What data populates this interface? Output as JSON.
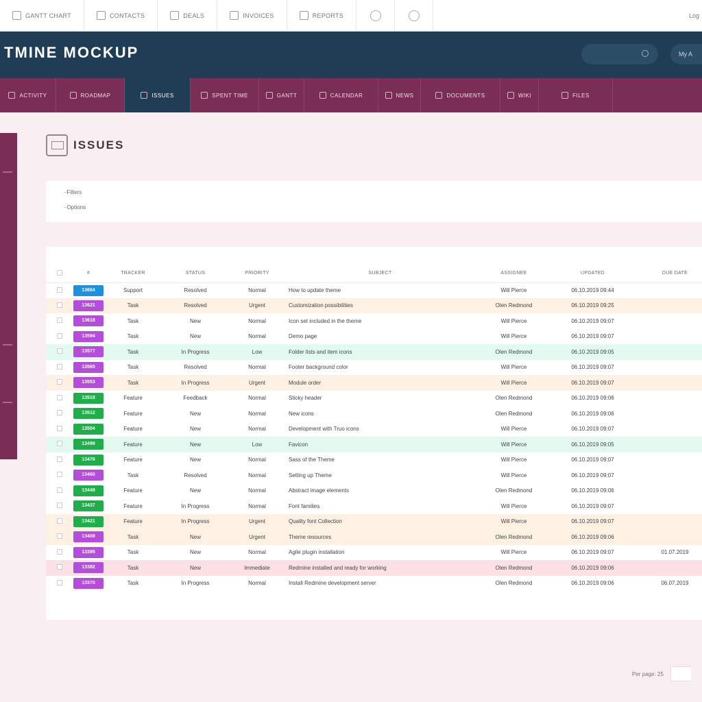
{
  "toolbar": {
    "items": [
      {
        "label": "Gantt chart",
        "icon": "gantt-icon"
      },
      {
        "label": "Contacts",
        "icon": "contacts-icon"
      },
      {
        "label": "Deals",
        "icon": "deals-icon"
      },
      {
        "label": "Invoices",
        "icon": "invoices-icon"
      },
      {
        "label": "Reports",
        "icon": "reports-icon"
      }
    ],
    "right_label": "Log"
  },
  "header": {
    "app_title": "TMINE MOCKUP",
    "my_account": "My A"
  },
  "tabs": [
    {
      "label": "Activity",
      "active": false
    },
    {
      "label": "Roadmap",
      "active": false
    },
    {
      "label": "Issues",
      "active": true
    },
    {
      "label": "Spent time",
      "active": false
    },
    {
      "label": "Gantt",
      "active": false
    },
    {
      "label": "Calendar",
      "active": false
    },
    {
      "label": "News",
      "active": false
    },
    {
      "label": "Documents",
      "active": false
    },
    {
      "label": "Wiki",
      "active": false
    },
    {
      "label": "Files",
      "active": false
    }
  ],
  "page": {
    "title": "Issues"
  },
  "filters": {
    "options": [
      "Filters",
      "Options"
    ]
  },
  "table": {
    "headers": [
      "#",
      "Tracker",
      "Status",
      "Priority",
      "Subject",
      "Assignee",
      "Updated",
      "Due date"
    ],
    "rows": [
      {
        "id": "13664",
        "tracker": "Support",
        "status": "Resolved",
        "priority": "Normal",
        "subject": "How to update theme",
        "assignee": "Will Pierce",
        "updated": "06.10.2019 09:44",
        "due": "",
        "badge": "#1e90e0",
        "hl": ""
      },
      {
        "id": "13621",
        "tracker": "Task",
        "status": "Resolved",
        "priority": "Urgent",
        "subject": "Customization possibilities",
        "assignee": "Olen Redmond",
        "updated": "06.10.2019 09:25",
        "due": "",
        "badge": "#b54ddb",
        "hl": "orange"
      },
      {
        "id": "13618",
        "tracker": "Task",
        "status": "New",
        "priority": "Normal",
        "subject": "Icon set included in the theme",
        "assignee": "Will Pierce",
        "updated": "06.10.2019 09:07",
        "due": "",
        "badge": "#b54ddb",
        "hl": ""
      },
      {
        "id": "13594",
        "tracker": "Task",
        "status": "New",
        "priority": "Normal",
        "subject": "Demo page",
        "assignee": "Will Pierce",
        "updated": "06.10.2019 09:07",
        "due": "",
        "badge": "#b54ddb",
        "hl": ""
      },
      {
        "id": "13577",
        "tracker": "Task",
        "status": "In Progress",
        "priority": "Low",
        "subject": "Folder lists and item icons",
        "assignee": "Olen Redmond",
        "updated": "06.10.2019 09:05",
        "due": "",
        "badge": "#b54ddb",
        "hl": "green"
      },
      {
        "id": "13565",
        "tracker": "Task",
        "status": "Resolved",
        "priority": "Normal",
        "subject": "Footer background color",
        "assignee": "Will Pierce",
        "updated": "06.10.2019 09:07",
        "due": "",
        "badge": "#b54ddb",
        "hl": ""
      },
      {
        "id": "13553",
        "tracker": "Task",
        "status": "In Progress",
        "priority": "Urgent",
        "subject": "Module order",
        "assignee": "Will Pierce",
        "updated": "06.10.2019 09:07",
        "due": "",
        "badge": "#b54ddb",
        "hl": "orange"
      },
      {
        "id": "13518",
        "tracker": "Feature",
        "status": "Feedback",
        "priority": "Normal",
        "subject": "Sticky header",
        "assignee": "Olen Redmond",
        "updated": "06.10.2019 09:06",
        "due": "",
        "badge": "#1fae4a",
        "hl": ""
      },
      {
        "id": "13512",
        "tracker": "Feature",
        "status": "New",
        "priority": "Normal",
        "subject": "New icons",
        "assignee": "Olen Redmond",
        "updated": "06.10.2019 09:06",
        "due": "",
        "badge": "#1fae4a",
        "hl": ""
      },
      {
        "id": "13504",
        "tracker": "Feature",
        "status": "New",
        "priority": "Normal",
        "subject": "Development with Truo icons",
        "assignee": "Will Pierce",
        "updated": "06.10.2019 09:07",
        "due": "",
        "badge": "#1fae4a",
        "hl": ""
      },
      {
        "id": "13499",
        "tracker": "Feature",
        "status": "New",
        "priority": "Low",
        "subject": "Favicon",
        "assignee": "Will Pierce",
        "updated": "06.10.2019 09:05",
        "due": "",
        "badge": "#1fae4a",
        "hl": "green"
      },
      {
        "id": "13476",
        "tracker": "Feature",
        "status": "New",
        "priority": "Normal",
        "subject": "Sass of the Theme",
        "assignee": "Will Pierce",
        "updated": "06.10.2019 09:07",
        "due": "",
        "badge": "#1fae4a",
        "hl": ""
      },
      {
        "id": "13460",
        "tracker": "Task",
        "status": "Resolved",
        "priority": "Normal",
        "subject": "Setting up Theme",
        "assignee": "Will Pierce",
        "updated": "06.10.2019 09:07",
        "due": "",
        "badge": "#b54ddb",
        "hl": ""
      },
      {
        "id": "13449",
        "tracker": "Feature",
        "status": "New",
        "priority": "Normal",
        "subject": "Abstract image elements",
        "assignee": "Olen Redmond",
        "updated": "06.10.2019 09:06",
        "due": "",
        "badge": "#1fae4a",
        "hl": ""
      },
      {
        "id": "13437",
        "tracker": "Feature",
        "status": "In Progress",
        "priority": "Normal",
        "subject": "Font families",
        "assignee": "Will Pierce",
        "updated": "06.10.2019 09:07",
        "due": "",
        "badge": "#1fae4a",
        "hl": ""
      },
      {
        "id": "13421",
        "tracker": "Feature",
        "status": "In Progress",
        "priority": "Urgent",
        "subject": "Quality font Collection",
        "assignee": "Will Pierce",
        "updated": "06.10.2019 09:07",
        "due": "",
        "badge": "#1fae4a",
        "hl": "orange"
      },
      {
        "id": "13408",
        "tracker": "Task",
        "status": "New",
        "priority": "Urgent",
        "subject": "Theme resources",
        "assignee": "Olen Redmond",
        "updated": "06.10.2019 09:06",
        "due": "",
        "badge": "#b54ddb",
        "hl": "orange"
      },
      {
        "id": "13395",
        "tracker": "Task",
        "status": "New",
        "priority": "Normal",
        "subject": "Agile plugin installation",
        "assignee": "Will Pierce",
        "updated": "06.10.2019 09:07",
        "due": "01.07.2019",
        "badge": "#b54ddb",
        "hl": ""
      },
      {
        "id": "13382",
        "tracker": "Task",
        "status": "New",
        "priority": "Immediate",
        "subject": "Redmine installed and ready for working",
        "assignee": "Olen Redmond",
        "updated": "06.10.2019 09:06",
        "due": "",
        "badge": "#b54ddb",
        "hl": "red"
      },
      {
        "id": "13370",
        "tracker": "Task",
        "status": "In Progress",
        "priority": "Normal",
        "subject": "Install Redmine development server",
        "assignee": "Olen Redmond",
        "updated": "06.10.2019 09:06",
        "due": "06.07.2019",
        "badge": "#b54ddb",
        "hl": ""
      }
    ]
  },
  "pagination": {
    "per_page_label": "Per page: 25"
  }
}
